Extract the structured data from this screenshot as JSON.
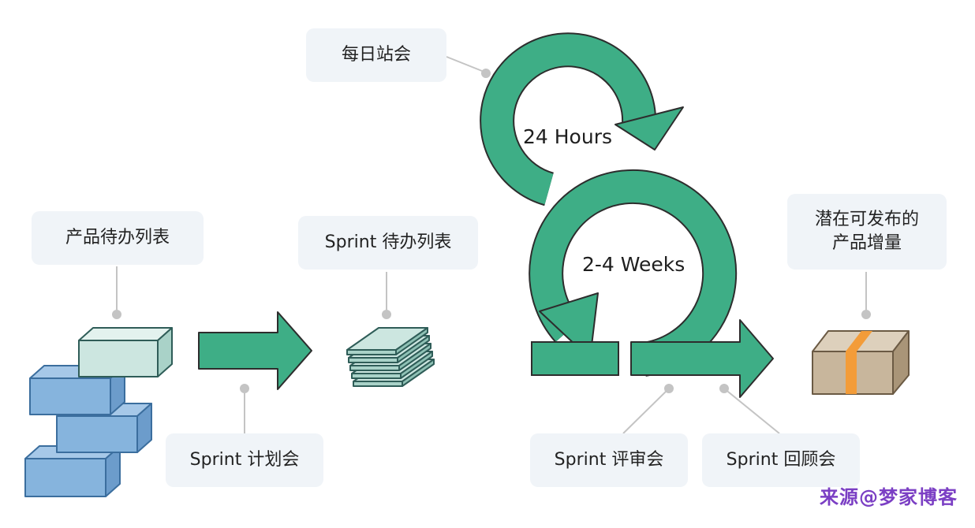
{
  "labels": {
    "daily_standup": "每日站会",
    "product_backlog": "产品待办列表",
    "sprint_backlog": "Sprint 待办列表",
    "sprint_planning": "Sprint 计划会",
    "sprint_review": "Sprint 评审会",
    "sprint_retro": "Sprint 回顾会",
    "increment_line1": "潜在可发布的",
    "increment_line2": "产品增量"
  },
  "cycles": {
    "daily": "24 Hours",
    "sprint": "2-4 Weeks"
  },
  "watermark": "来源@梦家博客",
  "colors": {
    "green": "#3eae86",
    "green_stroke": "#2d2d2d",
    "box_blue": "#86b4dd",
    "box_blue_stroke": "#3b6e9e",
    "box_teal": "#cce6e0",
    "package": "#c8b69c",
    "tape": "#f39c39",
    "connector": "#c4c4c4"
  }
}
